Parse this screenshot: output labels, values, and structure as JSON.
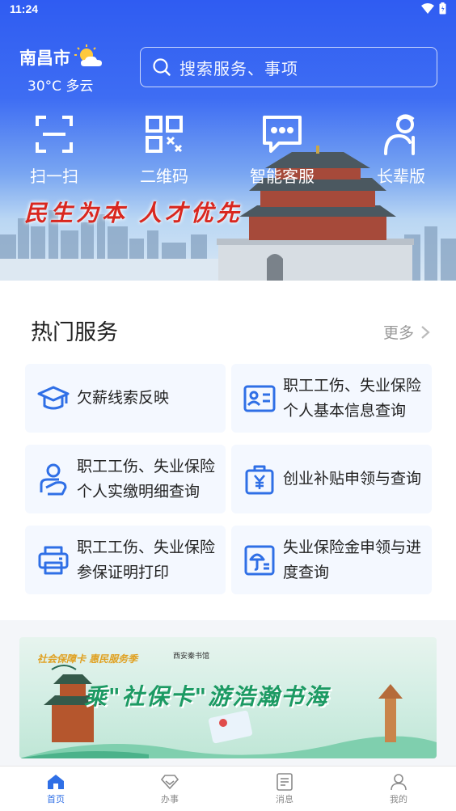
{
  "status": {
    "time": "11:24"
  },
  "header": {
    "city": "南昌市",
    "weather": "30°C 多云",
    "search_placeholder": "搜索服务、事项",
    "slogan": "民生为本 人才优先"
  },
  "quick_actions": [
    {
      "label": "扫一扫",
      "icon": "scan-icon"
    },
    {
      "label": "二维码",
      "icon": "qr-code-icon"
    },
    {
      "label": "智能客服",
      "icon": "chat-bubble-icon"
    },
    {
      "label": "长辈版",
      "icon": "elder-icon"
    }
  ],
  "hot_services": {
    "title": "热门服务",
    "more": "更多",
    "items": [
      {
        "label": "欠薪线索反映",
        "icon": "graduation-cap-icon"
      },
      {
        "label": "职工工伤、失业保险个人基本信息查询",
        "icon": "id-card-icon"
      },
      {
        "label": "职工工伤、失业保险个人实缴明细查询",
        "icon": "person-hand-icon"
      },
      {
        "label": "创业补贴申领与查询",
        "icon": "yuan-bag-icon"
      },
      {
        "label": "职工工伤、失业保险参保证明打印",
        "icon": "printer-icon"
      },
      {
        "label": "失业保险金申领与进度查询",
        "icon": "umbrella-doc-icon"
      }
    ]
  },
  "banner": {
    "tagline": "社会保障卡 惠民服务季",
    "partner": "西安秦书馆",
    "headline": "乘\"社保卡\"游浩瀚书海"
  },
  "tabs": [
    {
      "label": "首页",
      "icon": "home-icon",
      "active": true
    },
    {
      "label": "办事",
      "icon": "diamond-icon",
      "active": false
    },
    {
      "label": "消息",
      "icon": "message-doc-icon",
      "active": false
    },
    {
      "label": "我的",
      "icon": "user-icon",
      "active": false
    }
  ],
  "colors": {
    "accent": "#2f6fe6",
    "hero_top": "#2f5cf2",
    "slogan": "#d9271f"
  }
}
